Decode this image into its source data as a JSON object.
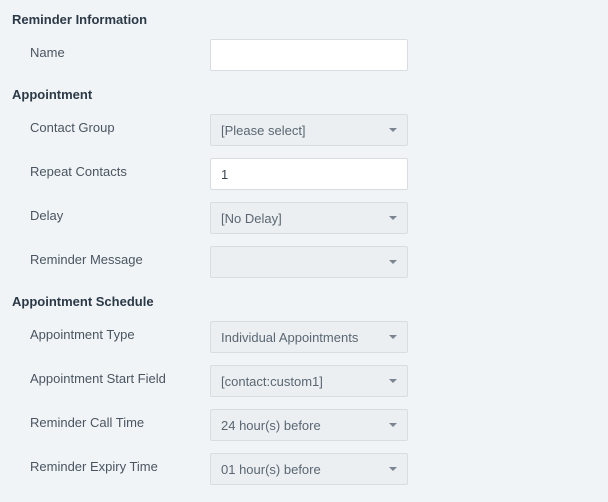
{
  "sections": {
    "reminder_info": {
      "header": "Reminder Information",
      "fields": {
        "name": {
          "label": "Name",
          "value": ""
        }
      }
    },
    "appointment": {
      "header": "Appointment",
      "fields": {
        "contact_group": {
          "label": "Contact Group",
          "selected": "[Please select]"
        },
        "repeat_contacts": {
          "label": "Repeat Contacts",
          "value": "1"
        },
        "delay": {
          "label": "Delay",
          "selected": "[No Delay]"
        },
        "reminder_message": {
          "label": "Reminder Message",
          "selected": ""
        }
      }
    },
    "schedule": {
      "header": "Appointment Schedule",
      "fields": {
        "appointment_type": {
          "label": "Appointment Type",
          "selected": "Individual Appointments"
        },
        "appointment_start_field": {
          "label": "Appointment Start Field",
          "selected": "[contact:custom1]"
        },
        "reminder_call_time": {
          "label": "Reminder Call Time",
          "selected": "24 hour(s) before"
        },
        "reminder_expiry_time": {
          "label": "Reminder Expiry Time",
          "selected": "01 hour(s) before"
        }
      }
    }
  }
}
